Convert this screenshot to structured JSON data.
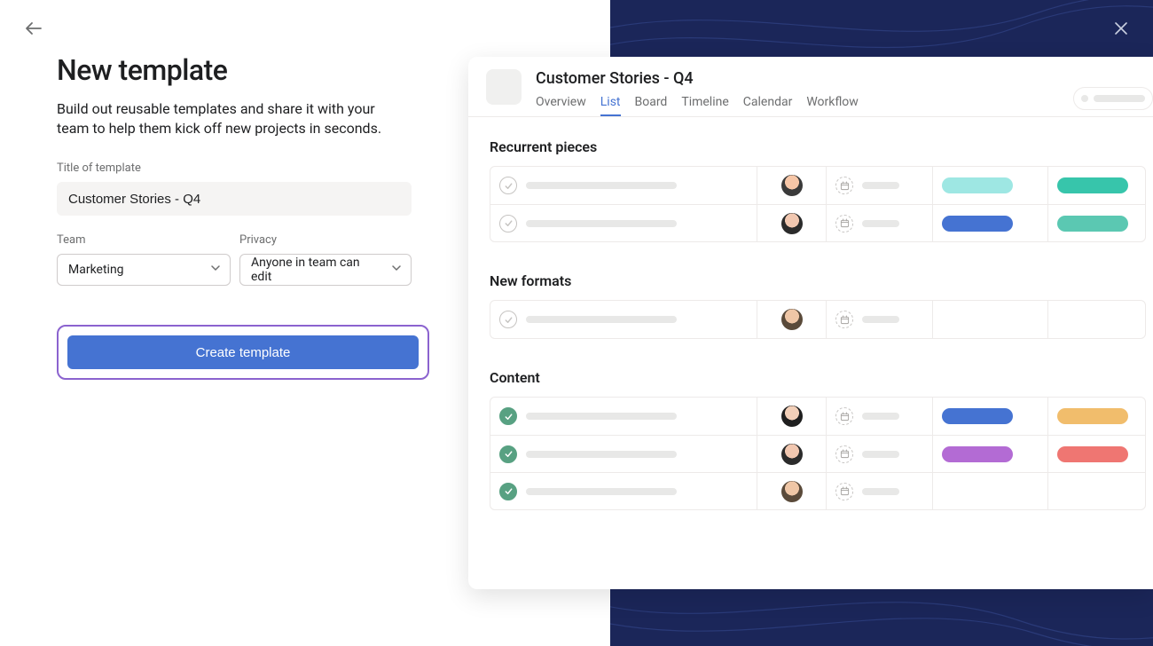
{
  "header": {
    "title": "New template",
    "subtitle": "Build out reusable templates and share it with your team to help them kick off new projects in seconds."
  },
  "form": {
    "title_label": "Title of template",
    "title_value": "Customer Stories - Q4",
    "team_label": "Team",
    "team_value": "Marketing",
    "privacy_label": "Privacy",
    "privacy_value": "Anyone in team can edit",
    "submit_label": "Create template"
  },
  "preview": {
    "project_name": "Customer Stories - Q4",
    "tabs": [
      "Overview",
      "List",
      "Board",
      "Timeline",
      "Calendar",
      "Workflow"
    ],
    "active_tab": "List",
    "sections": [
      {
        "title": "Recurrent pieces",
        "rows": [
          {
            "done": false,
            "avatar": "av1",
            "tag1": "teal",
            "tag2": "green"
          },
          {
            "done": false,
            "avatar": "av2",
            "tag1": "blue",
            "tag2": "teal2"
          }
        ]
      },
      {
        "title": "New formats",
        "rows": [
          {
            "done": false,
            "avatar": "av3",
            "tag1": "",
            "tag2": ""
          }
        ]
      },
      {
        "title": "Content",
        "rows": [
          {
            "done": true,
            "avatar": "av4",
            "tag1": "blue",
            "tag2": "orange"
          },
          {
            "done": true,
            "avatar": "av2",
            "tag1": "purple",
            "tag2": "red"
          },
          {
            "done": true,
            "avatar": "av3",
            "tag1": "",
            "tag2": ""
          }
        ]
      }
    ]
  },
  "colors": {
    "primary_button": "#4573d2",
    "focus_ring": "#8b63cf",
    "dark_bg": "#1b2659"
  }
}
